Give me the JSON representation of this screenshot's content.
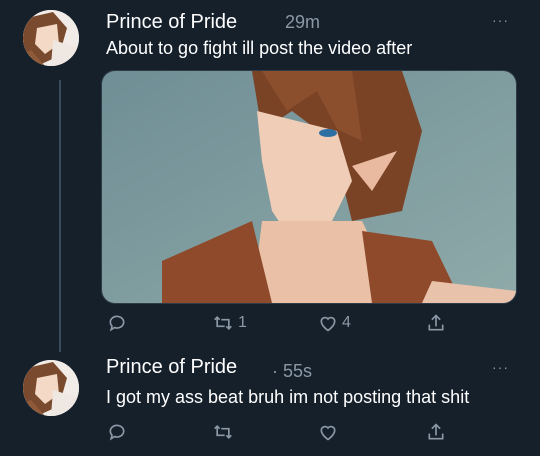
{
  "colors": {
    "background": "#15202b",
    "secondary_text": "#8b98a5",
    "primary_text": "#ffffff"
  },
  "tweets": [
    {
      "name": "Prince of Pride",
      "time": "29m",
      "text": "About to go fight ill post the video after",
      "more": "···",
      "has_media": true,
      "actions": {
        "reply_icon": "reply-icon",
        "retweet_icon": "retweet-icon",
        "retweet_count": "1",
        "like_icon": "like-icon",
        "like_count": "4",
        "share_icon": "share-icon"
      }
    },
    {
      "name": "Prince of Pride",
      "time": "· 55s",
      "text": "I got my ass beat bruh im not posting that shit",
      "more": "···",
      "has_media": false,
      "actions": {
        "reply_icon": "reply-icon",
        "retweet_icon": "retweet-icon",
        "retweet_count": "",
        "like_icon": "like-icon",
        "like_count": "",
        "share_icon": "share-icon"
      }
    }
  ]
}
